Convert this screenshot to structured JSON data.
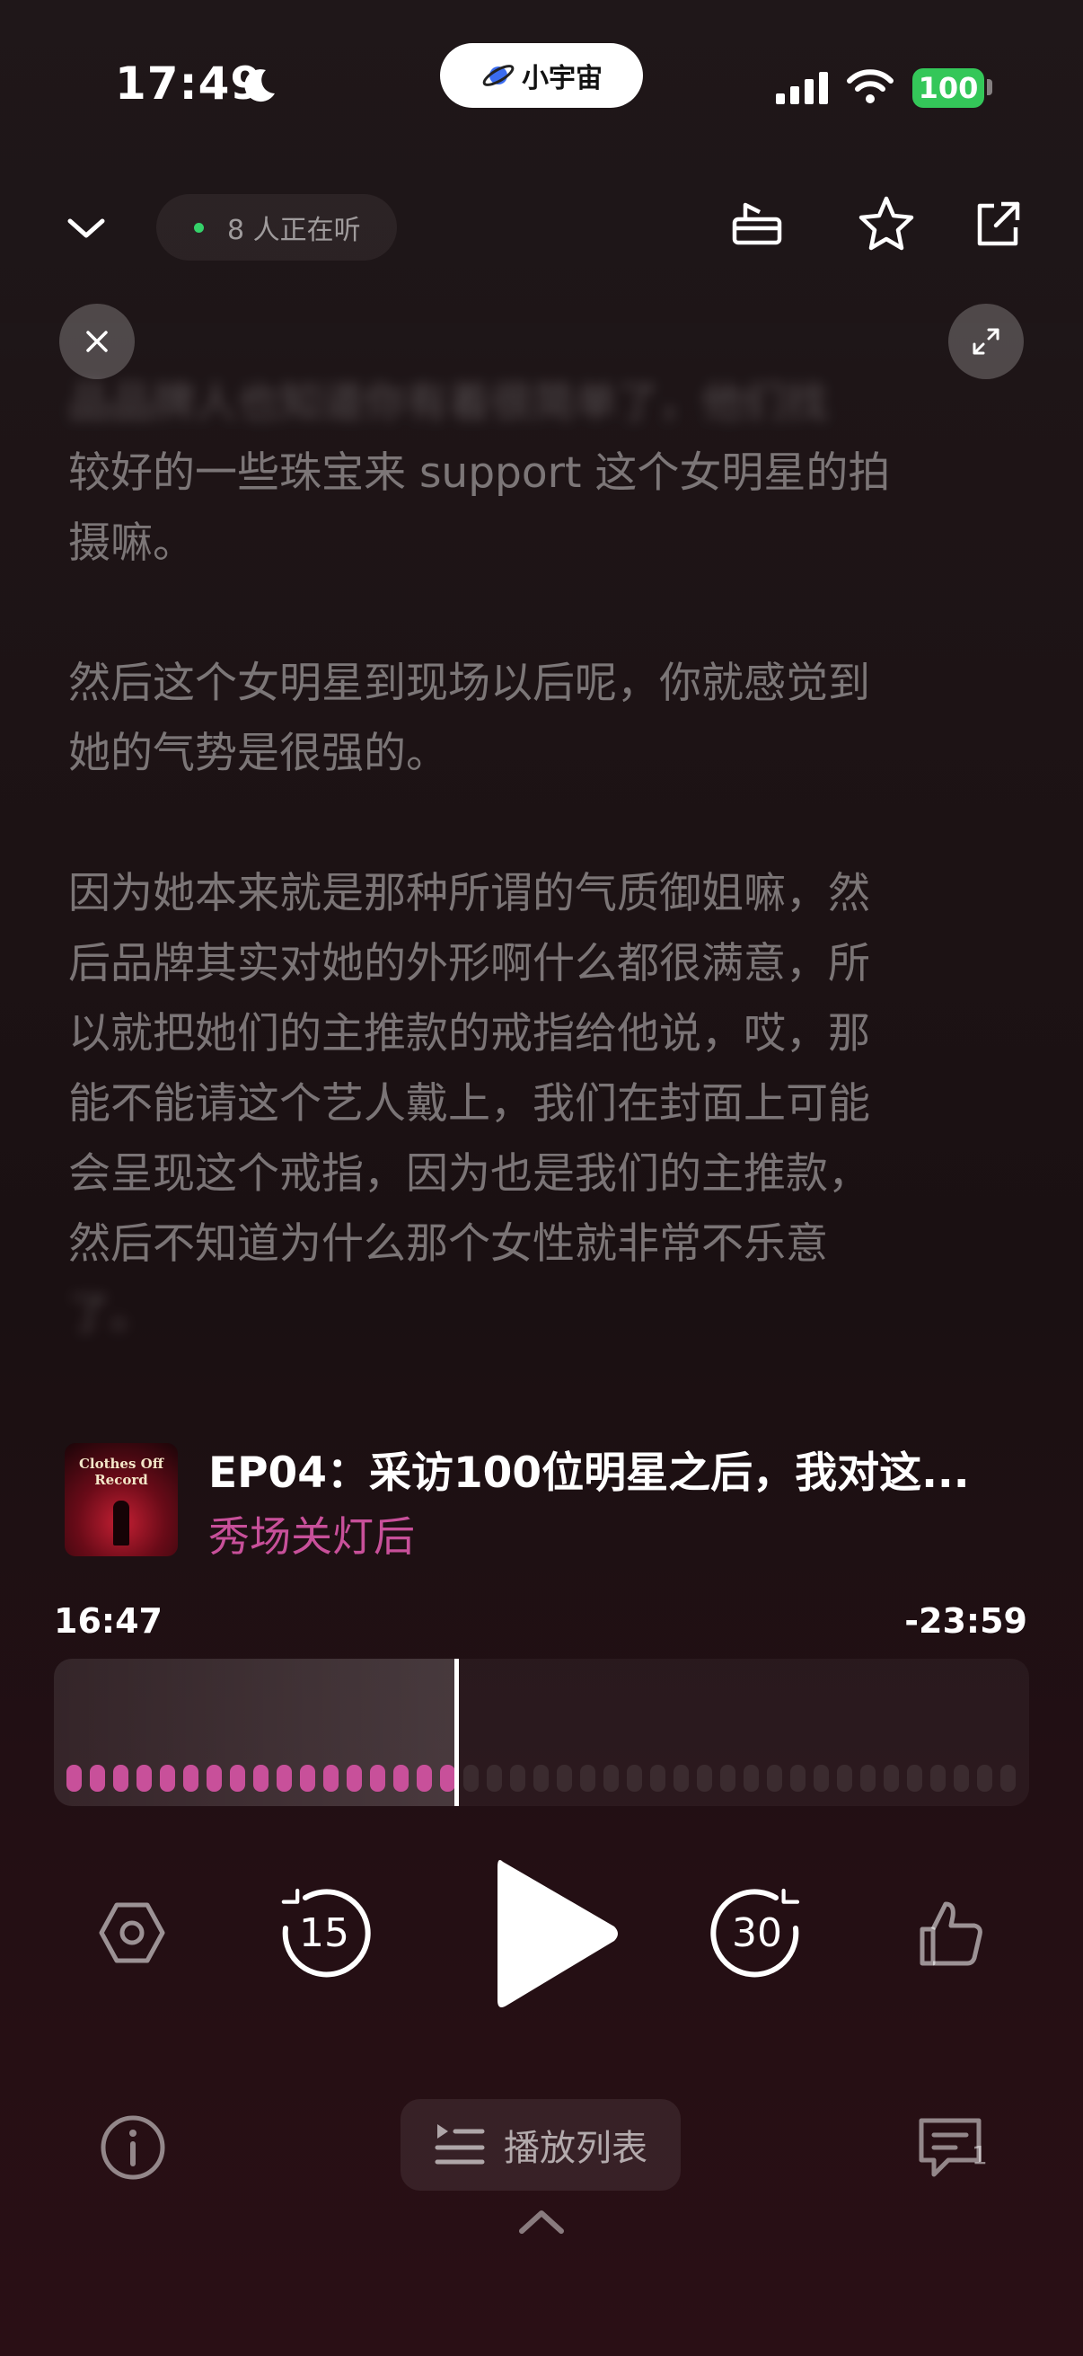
{
  "status_bar": {
    "time": "17:49",
    "moon_icon": "moon-icon",
    "island_app": "小宇宙",
    "battery": "100"
  },
  "header": {
    "listeners": "8 人正在听"
  },
  "transcript": {
    "blurred_line": "品品牌人也知道你有着很简单了，他们找",
    "para1_lines": [
      "较好的一些珠宝来 support 这个女明星的拍",
      "摄嘛。"
    ],
    "para2_lines": [
      "然后这个女明星到现场以后呢，你就感觉到",
      "她的气势是很强的。"
    ],
    "para3_lines": [
      "因为她本来就是那种所谓的气质御姐嘛，然",
      "后品牌其实对她的外形啊什么都很满意，所",
      "以就把她们的主推款的戒指给他说，哎，那",
      "能不能请这个艺人戴上，我们在封面上可能",
      "会呈现这个戒指，因为也是我们的主推款，",
      "然后不知道为什么那个女性就非常不乐意"
    ],
    "tail_line": "了。"
  },
  "episode": {
    "cover_text": "Clothes Off Record",
    "title": "EP04：采访100位明星之后，我对这...",
    "show": "秀场关灯后"
  },
  "player": {
    "elapsed": "16:47",
    "remaining": "-23:59",
    "progress_fraction": 0.4126,
    "skip_back": "15",
    "skip_forward": "30"
  },
  "bottom": {
    "playlist_label": "播放列表",
    "comment_count": "1"
  },
  "colors": {
    "accent": "#c8509a",
    "battery": "#34c759"
  }
}
